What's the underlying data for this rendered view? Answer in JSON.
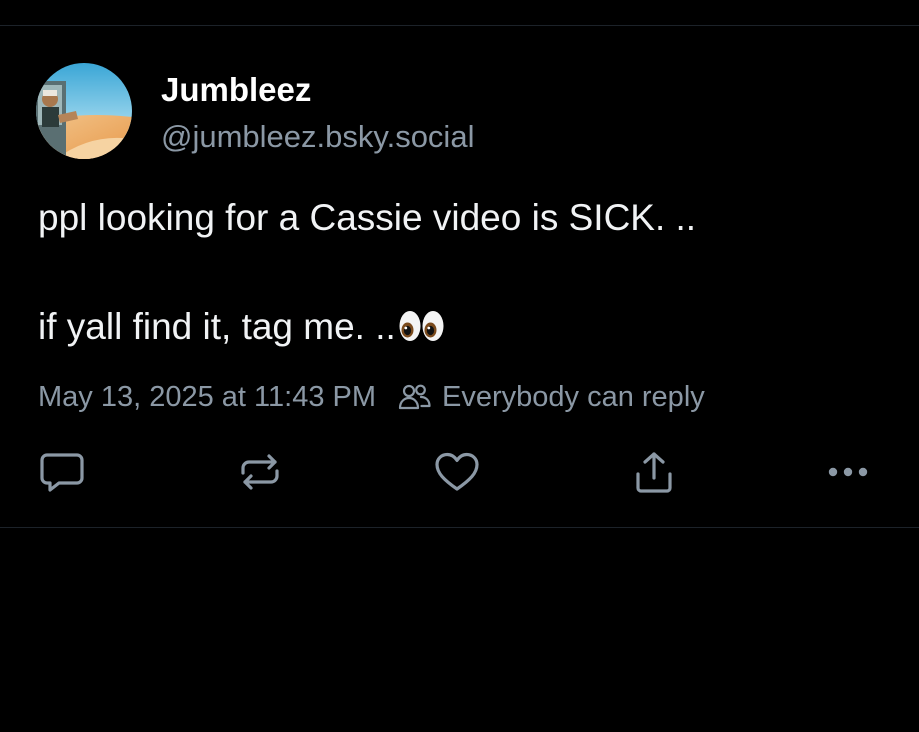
{
  "post": {
    "author": {
      "display_name": "Jumbleez",
      "handle": "@jumbleez.bsky.social",
      "avatar_icon": "avatar-photo"
    },
    "text_lines": [
      "ppl looking for a Cassie video is SICK. ..",
      "if yall find it, tag me. .."
    ],
    "emoji": "eyes-emoji",
    "timestamp": "May 13, 2025 at 11:43 PM",
    "reply_setting": "Everybody can reply",
    "actions": [
      {
        "name": "reply",
        "icon": "speech-bubble-icon"
      },
      {
        "name": "repost",
        "icon": "repost-arrows-icon"
      },
      {
        "name": "like",
        "icon": "heart-icon"
      },
      {
        "name": "share",
        "icon": "share-upload-icon"
      },
      {
        "name": "more",
        "icon": "ellipsis-icon"
      }
    ]
  },
  "colors": {
    "background": "#000000",
    "primary_text": "#ffffff",
    "secondary_text": "#8b98a5",
    "divider": "#1c2229"
  }
}
